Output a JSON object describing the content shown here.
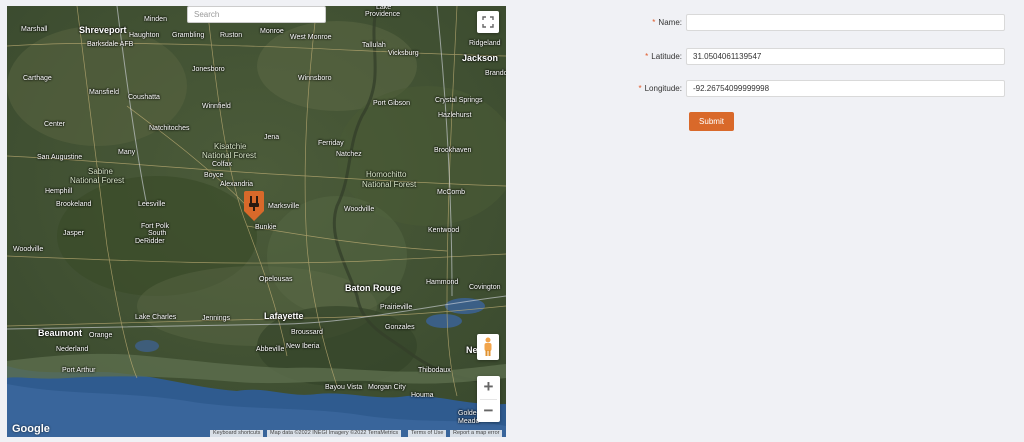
{
  "map": {
    "search_placeholder": "Search",
    "cities": [
      {
        "id": "minden",
        "label": "Minden"
      },
      {
        "id": "shreveport",
        "label": "Shreveport"
      },
      {
        "id": "marshall",
        "label": "Marshall"
      },
      {
        "id": "haughton",
        "label": "Haughton"
      },
      {
        "id": "grambling",
        "label": "Grambling"
      },
      {
        "id": "ruston",
        "label": "Ruston"
      },
      {
        "id": "monroe",
        "label": "Monroe"
      },
      {
        "id": "westmonroe",
        "label": "West Monroe"
      },
      {
        "id": "lake",
        "label": "Lake"
      },
      {
        "id": "providence",
        "label": "Providence"
      },
      {
        "id": "tallulah",
        "label": "Tallulah"
      },
      {
        "id": "vicksburg",
        "label": "Vicksburg"
      },
      {
        "id": "ridgeland",
        "label": "Ridgeland"
      },
      {
        "id": "jackson",
        "label": "Jackson"
      },
      {
        "id": "brandon",
        "label": "Brando"
      },
      {
        "id": "barksdale",
        "label": "Barksdale AFB"
      },
      {
        "id": "jonesboro",
        "label": "Jonesboro"
      },
      {
        "id": "carthage",
        "label": "Carthage"
      },
      {
        "id": "mansfield",
        "label": "Mansfield"
      },
      {
        "id": "coushatta",
        "label": "Coushatta"
      },
      {
        "id": "winnfield",
        "label": "Winnfield"
      },
      {
        "id": "winnsboro",
        "label": "Winnsboro"
      },
      {
        "id": "portgibson",
        "label": "Port Gibson"
      },
      {
        "id": "crystalsprings",
        "label": "Crystal Springs"
      },
      {
        "id": "hazlehurst",
        "label": "Hazlehurst"
      },
      {
        "id": "center",
        "label": "Center"
      },
      {
        "id": "natchitoches",
        "label": "Natchitoches"
      },
      {
        "id": "jena",
        "label": "Jena"
      },
      {
        "id": "ferriday",
        "label": "Ferriday"
      },
      {
        "id": "natchez",
        "label": "Natchez"
      },
      {
        "id": "brookhaven",
        "label": "Brookhaven"
      },
      {
        "id": "sanaugustine",
        "label": "San Augustine"
      },
      {
        "id": "many",
        "label": "Many"
      },
      {
        "id": "kisatchie",
        "label": "Kisatchie"
      },
      {
        "id": "nationalforest1",
        "label": "National Forest"
      },
      {
        "id": "colfax",
        "label": "Colfax"
      },
      {
        "id": "sabine",
        "label": "Sabine"
      },
      {
        "id": "nationalforest2",
        "label": "National Forest"
      },
      {
        "id": "boyce",
        "label": "Boyce"
      },
      {
        "id": "alexandria",
        "label": "Alexandria"
      },
      {
        "id": "homochitto",
        "label": "Homochitto"
      },
      {
        "id": "nationalforest3",
        "label": "National Forest"
      },
      {
        "id": "hemphill",
        "label": "Hemphill"
      },
      {
        "id": "marksville",
        "label": "Marksville"
      },
      {
        "id": "mccomb",
        "label": "McComb"
      },
      {
        "id": "brookeland",
        "label": "Brookeland"
      },
      {
        "id": "leesville",
        "label": "Leesville"
      },
      {
        "id": "woodville",
        "label": "Woodville"
      },
      {
        "id": "bunkie",
        "label": "Bunkie"
      },
      {
        "id": "kentwood",
        "label": "Kentwood"
      },
      {
        "id": "fortpolk",
        "label": "Fort Polk"
      },
      {
        "id": "south",
        "label": "South"
      },
      {
        "id": "jasper",
        "label": "Jasper"
      },
      {
        "id": "deridder",
        "label": "DeRidder"
      },
      {
        "id": "woodville2",
        "label": "Woodville"
      },
      {
        "id": "opelousas",
        "label": "Opelousas"
      },
      {
        "id": "hammond",
        "label": "Hammond"
      },
      {
        "id": "covington",
        "label": "Covington"
      },
      {
        "id": "batonrouge",
        "label": "Baton Rouge"
      },
      {
        "id": "prairieville",
        "label": "Prairieville"
      },
      {
        "id": "lakecharles",
        "label": "Lake Charles"
      },
      {
        "id": "jennings",
        "label": "Jennings"
      },
      {
        "id": "lafayette",
        "label": "Lafayette"
      },
      {
        "id": "broussard",
        "label": "Broussard"
      },
      {
        "id": "gonzales",
        "label": "Gonzales"
      },
      {
        "id": "beaumont",
        "label": "Beaumont"
      },
      {
        "id": "orange",
        "label": "Orange"
      },
      {
        "id": "nederland",
        "label": "Nederland"
      },
      {
        "id": "abbeville",
        "label": "Abbeville"
      },
      {
        "id": "newiberia",
        "label": "New Iberia"
      },
      {
        "id": "neworleans",
        "label": "Ne"
      },
      {
        "id": "portarthur",
        "label": "Port Arthur"
      },
      {
        "id": "thibodaux",
        "label": "Thibodaux"
      },
      {
        "id": "bayouvista",
        "label": "Bayou Vista"
      },
      {
        "id": "morgancity",
        "label": "Morgan City"
      },
      {
        "id": "houma",
        "label": "Houma"
      },
      {
        "id": "golden",
        "label": "Golde"
      },
      {
        "id": "meadow",
        "label": "Meado"
      }
    ],
    "google_logo": "Google",
    "attribution": {
      "shortcuts": "Keyboard shortcuts",
      "data": "Map data ©2022 INEGI Imagery ©2022 TerraMetrics",
      "terms": "Terms of Use",
      "report": "Report a map error"
    },
    "zoom_in": "+",
    "zoom_out": "−",
    "marker_color": "#d9692a"
  },
  "form": {
    "name_label": "Name",
    "name_value": "",
    "latitude_label": "Latitude",
    "latitude_value": "31.0504061139547",
    "longitude_label": "Longitude",
    "longitude_value": "-92.26754099999998",
    "required_mark": "*",
    "colon": ":",
    "submit_label": "Submit",
    "accent_color": "#d9692a"
  }
}
